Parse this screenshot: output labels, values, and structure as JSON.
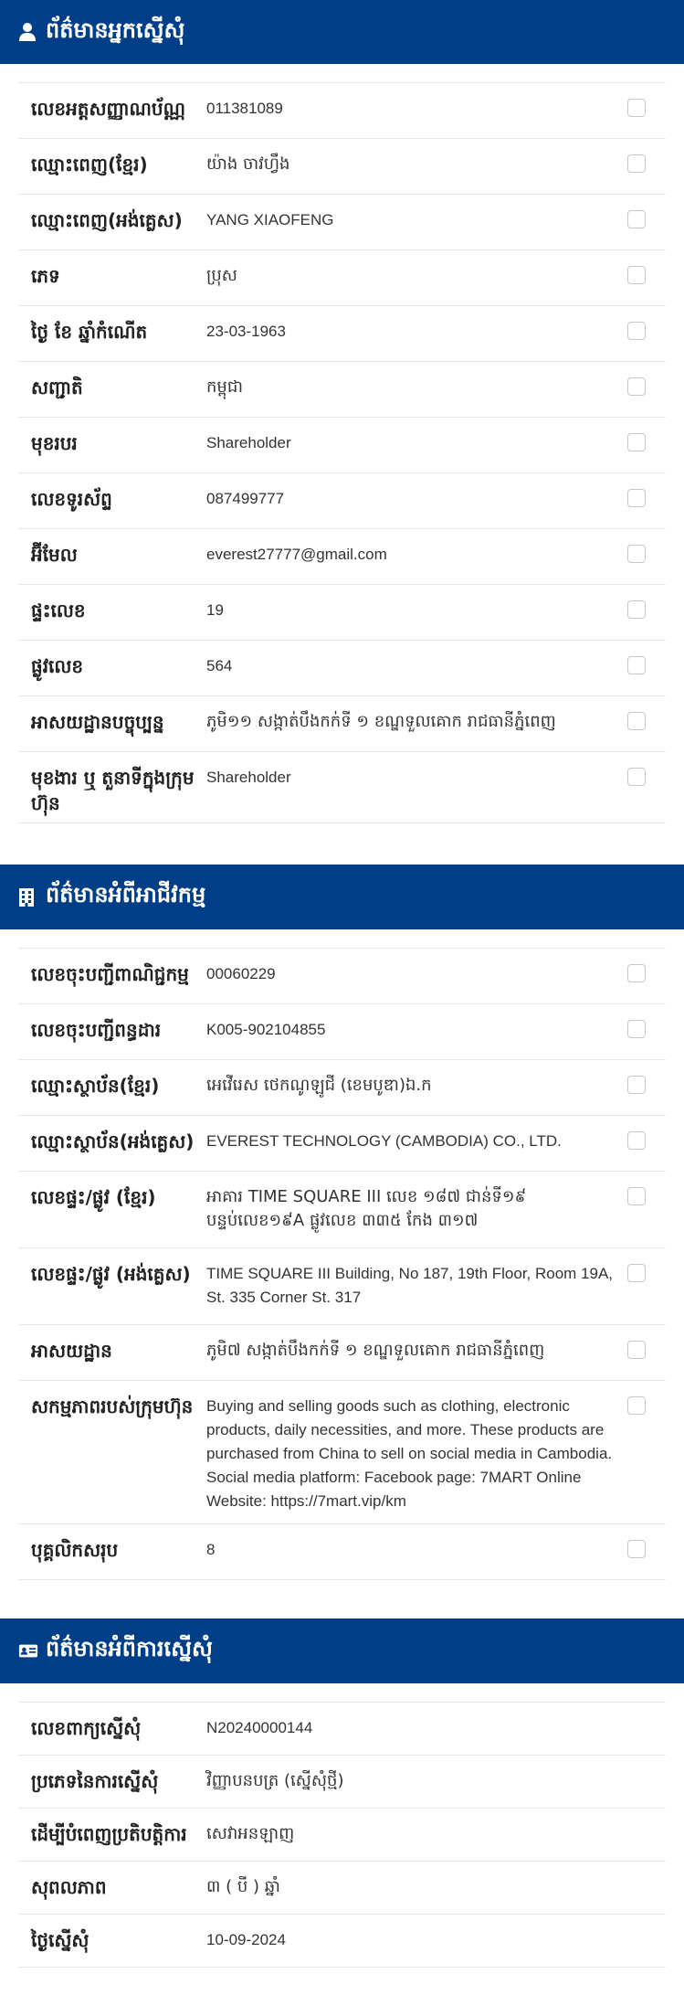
{
  "applicant": {
    "title": "ព័ត៌មានអ្នកស្នើសុំ",
    "rows": [
      {
        "label": "លេខអត្តសញ្ញាណប័ណ្ណ",
        "value": "011381089"
      },
      {
        "label": "ឈ្មោះពេញ(ខ្មែរ)",
        "value": "យ៉ាង ចាវហ្វឹង"
      },
      {
        "label": "ឈ្មោះពេញ(អង់គ្លេស)",
        "value": "YANG XIAOFENG"
      },
      {
        "label": "ភេទ",
        "value": "ប្រុស"
      },
      {
        "label": "ថ្ងៃ ខែ ឆ្នាំកំណើត",
        "value": "23-03-1963"
      },
      {
        "label": "សញ្ជាតិ",
        "value": "កម្ពុជា"
      },
      {
        "label": "មុខរបរ",
        "value": "Shareholder"
      },
      {
        "label": "លេខទូរស័ព្ទ",
        "value": "087499777"
      },
      {
        "label": "អ៊ីមែល",
        "value": "everest27777@gmail.com"
      },
      {
        "label": "ផ្ទះលេខ",
        "value": "19"
      },
      {
        "label": "ផ្លូវលេខ",
        "value": "564"
      },
      {
        "label": "អាសយដ្ឋានបច្ចុប្បន្ន",
        "value": "ភូមិ១១ សង្កាត់បឹងកក់ទី ១ ខណ្ឌទួលគោក រាជធានីភ្នំពេញ"
      },
      {
        "label": "មុខងារ ឬ តួនាទីក្នុងក្រុមហ៊ុន",
        "value": "Shareholder"
      }
    ]
  },
  "business": {
    "title": "ព័ត៌មានអំពីអាជីវកម្ម",
    "rows": [
      {
        "label": "លេខចុះបញ្ជីពាណិជ្ជកម្ម",
        "value": "00060229"
      },
      {
        "label": "លេខចុះបញ្ជីពន្ធដារ",
        "value": "K005-902104855"
      },
      {
        "label": "ឈ្មោះស្ថាប័ន(ខ្មែរ)",
        "value": "អេវើរេស ថេកណូឡូជី (ខេមបូឌា)ឯ.ក"
      },
      {
        "label": "ឈ្មោះស្ថាប័ន(អង់គ្លេស)",
        "value": "EVEREST TECHNOLOGY (CAMBODIA) CO., LTD."
      },
      {
        "label": "លេខផ្ទះ/ផ្លូវ (ខ្មែរ)",
        "value": "អាគារ TIME SQUARE III លេខ ១៨៧ ជាន់ទី១៩ បន្ទប់លេខ១៩A ផ្លូវលេខ ៣៣៥ កែង ៣១៧"
      },
      {
        "label": "លេខផ្ទះ/ផ្លូវ (អង់គ្លេស)",
        "value": "TIME SQUARE III Building, No 187, 19th Floor, Room 19A, St. 335 Corner St. 317"
      },
      {
        "label": "អាសយដ្ឋាន",
        "value": "ភូមិ៧ សង្កាត់បឹងកក់ទី ១ ខណ្ឌទួលគោក រាជធានីភ្នំពេញ"
      },
      {
        "label": "សកម្មភាពរបស់ក្រុមហ៊ុន",
        "value": "Buying and selling goods such as clothing, electronic products, daily necessities, and more. These products are purchased from China to sell on social media in Cambodia. Social media platform: Facebook page: 7MART Online Website: https://7mart.vip/km"
      },
      {
        "label": "បុគ្គលិកសរុប",
        "value": "8"
      }
    ]
  },
  "request": {
    "title": "ព័ត៌មានអំពីការស្នើសុំ",
    "rows": [
      {
        "label": "លេខពាក្យស្នើសុំ",
        "value": "N20240000144"
      },
      {
        "label": "ប្រភេទនៃការស្នើសុំ",
        "value": "វិញ្ញាបនបត្រ (ស្នើសុំថ្មី)"
      },
      {
        "label": "ដើម្បីបំពេញប្រតិបត្តិការ",
        "value": "សេវាអនឡាញ"
      },
      {
        "label": "សុពលភាព",
        "value": "៣ ( បី ) ឆ្នាំ"
      },
      {
        "label": "ថ្ងៃស្នើសុំ",
        "value": "10-09-2024"
      }
    ]
  },
  "colors": {
    "header_bg": "#003f87",
    "header_text": "#ffffff"
  },
  "icons": [
    "user-icon",
    "building-icon",
    "id-card-icon"
  ]
}
